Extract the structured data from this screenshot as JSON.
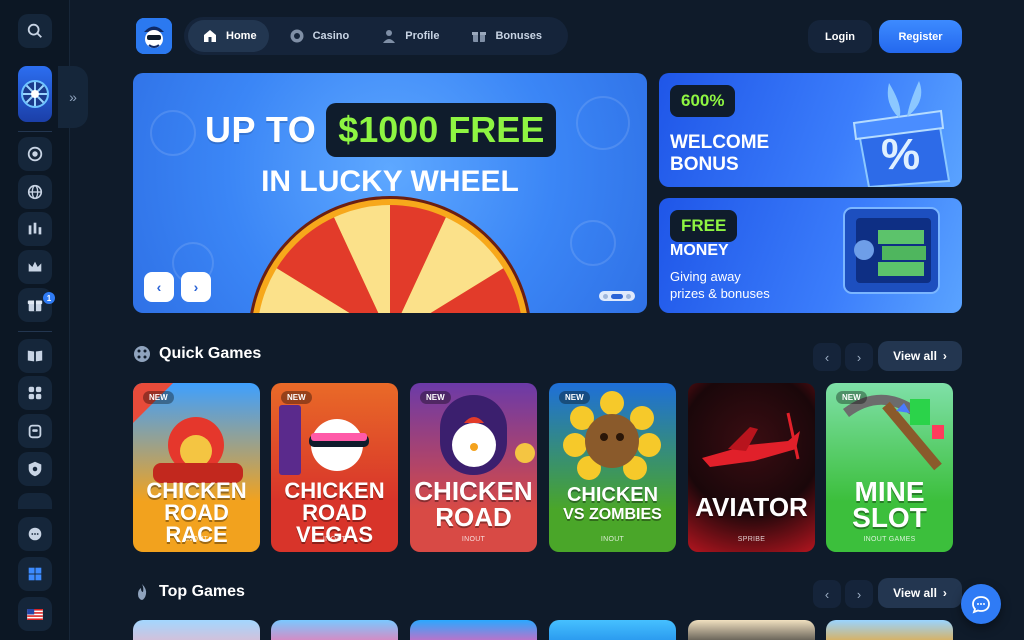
{
  "nav": {
    "items": [
      {
        "label": "Home",
        "active": true,
        "icon": "home-icon"
      },
      {
        "label": "Casino",
        "active": false,
        "icon": "casino-chip-icon"
      },
      {
        "label": "Profile",
        "active": false,
        "icon": "user-icon"
      },
      {
        "label": "Bonuses",
        "active": false,
        "icon": "gift-icon"
      }
    ]
  },
  "auth": {
    "login": "Login",
    "register": "Register"
  },
  "sidebar": {
    "icons": [
      "search-icon",
      "casino-chip-icon",
      "globe-icon",
      "chart-bars-icon",
      "crown-icon",
      "gift-icon",
      "book-icon",
      "games-icon",
      "box-icon",
      "shield-icon",
      "chat-support-icon",
      "windows-icon",
      "flag-us-icon"
    ],
    "gift_badge": "1"
  },
  "hero": {
    "line1_prefix": "UP TO",
    "line1_highlight": "$1000 FREE",
    "line2": "IN LUCKY WHEEL",
    "prev": "‹",
    "next": "›"
  },
  "promos": [
    {
      "pill": "600%",
      "title_lines": [
        "WELCOME",
        "BONUS"
      ],
      "subtitle_lines": []
    },
    {
      "pill": "FREE",
      "title_lines": [
        "MONEY"
      ],
      "subtitle_lines": [
        "Giving away",
        "prizes & bonuses"
      ]
    }
  ],
  "sections": {
    "quick": {
      "title": "Quick Games",
      "view_all": "View all"
    },
    "top": {
      "title": "Top Games",
      "view_all": "View all"
    }
  },
  "quick_games": [
    {
      "title_lines": [
        "CHICKEN",
        "ROAD RACE"
      ],
      "provider": "INOUT",
      "new": "NEW",
      "color": "#f2a21e"
    },
    {
      "title_lines": [
        "CHICKEN",
        "ROAD VEGAS"
      ],
      "provider": "INOUT",
      "new": "NEW",
      "color": "#e0452f"
    },
    {
      "title_lines": [
        "CHICKEN",
        "ROAD"
      ],
      "provider": "INOUT",
      "new": "NEW",
      "color": "#d84a45"
    },
    {
      "title_lines": [
        "CHICKEN",
        "VS ZOMBIES"
      ],
      "provider": "INOUT",
      "new": "NEW",
      "color": "#4aa629"
    },
    {
      "title_lines": [
        "AVIATOR"
      ],
      "provider": "SPRIBE",
      "new": "",
      "color": "#b3151f"
    },
    {
      "title_lines": [
        "MINE",
        "SLOT"
      ],
      "provider": "INOUT GAMES",
      "new": "NEW",
      "color": "#3cbf3c"
    }
  ],
  "colors": {
    "accent": "#2f7bf5",
    "highlight_green": "#8ef542",
    "bg": "#0f1b2a"
  }
}
